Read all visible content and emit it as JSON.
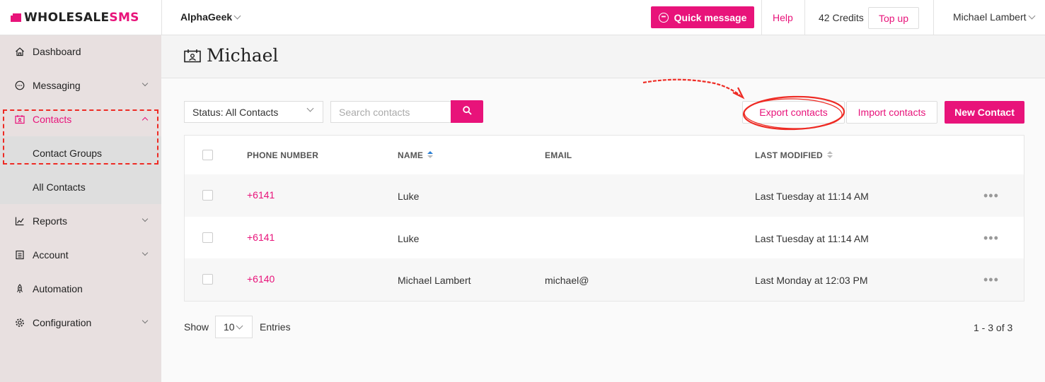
{
  "brand": {
    "name_part1": "WHOLESALE",
    "name_part2": "SMS"
  },
  "header": {
    "org": "AlphaGeek",
    "quick_message": "Quick message",
    "help": "Help",
    "credits": "42 Credits",
    "top_up": "Top up",
    "user": "Michael Lambert"
  },
  "sidebar": {
    "items": [
      {
        "label": "Dashboard",
        "icon": "home-icon"
      },
      {
        "label": "Messaging",
        "icon": "chat-icon"
      },
      {
        "label": "Contacts",
        "icon": "contact-card-icon"
      },
      {
        "label": "Reports",
        "icon": "chart-icon"
      },
      {
        "label": "Account",
        "icon": "account-icon"
      },
      {
        "label": "Automation",
        "icon": "rocket-icon"
      },
      {
        "label": "Configuration",
        "icon": "gear-icon"
      }
    ],
    "sub_items": [
      {
        "label": "Contact Groups"
      },
      {
        "label": "All Contacts"
      }
    ]
  },
  "page": {
    "title": "Michael"
  },
  "toolbar": {
    "status_filter": "Status: All Contacts",
    "search_placeholder": "Search contacts",
    "export": "Export contacts",
    "import": "Import contacts",
    "new_contact": "New Contact"
  },
  "table": {
    "columns": [
      "PHONE NUMBER",
      "NAME",
      "EMAIL",
      "LAST MODIFIED"
    ],
    "rows": [
      {
        "phone": "+6141",
        "name": "Luke",
        "email": "",
        "modified": "Last Tuesday at 11:14 AM"
      },
      {
        "phone": "+6141",
        "name": "Luke",
        "email": "",
        "modified": "Last Tuesday at 11:14 AM"
      },
      {
        "phone": "+6140",
        "name": "Michael Lambert",
        "email": "michael@",
        "modified": "Last Monday at 12:03 PM"
      }
    ]
  },
  "footer": {
    "show": "Show",
    "entries_value": "10",
    "entries": "Entries",
    "pagination": "1 - 3 of 3"
  },
  "colors": {
    "accent": "#e8137a",
    "annotation": "#ee2b24"
  }
}
